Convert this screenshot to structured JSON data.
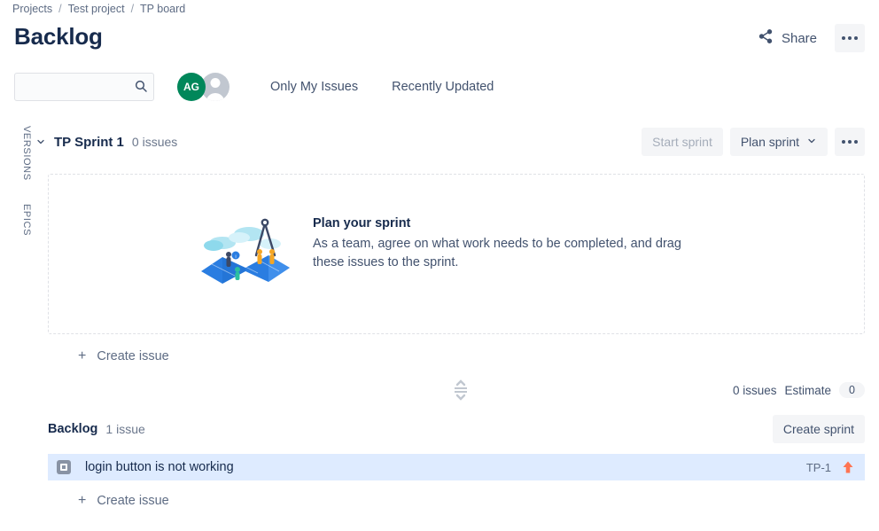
{
  "breadcrumb": {
    "items": [
      {
        "label": "Projects"
      },
      {
        "label": "Test project"
      },
      {
        "label": "TP board"
      }
    ],
    "separator": "/"
  },
  "header": {
    "title": "Backlog",
    "share_label": "Share",
    "share_icon": "share-icon",
    "more_icon": "ellipsis-icon"
  },
  "toolbar": {
    "search": {
      "value": "",
      "placeholder": "",
      "icon": "search-icon"
    },
    "avatars": [
      {
        "name": "avatar-ag",
        "initials": "AG",
        "color": "#00875a"
      },
      {
        "name": "avatar-anonymous",
        "initials": "",
        "color": "#c1c7d0"
      }
    ],
    "filters": [
      {
        "label": "Only My Issues"
      },
      {
        "label": "Recently Updated"
      }
    ]
  },
  "rail": {
    "versions_label": "VERSIONS",
    "epics_label": "EPICS"
  },
  "sprint": {
    "toggle_icon": "chevron-down-icon",
    "name": "TP Sprint 1",
    "issue_count": "0 issues",
    "start_button": "Start sprint",
    "plan_button": "Plan sprint",
    "plan_chevron_icon": "chevron-down-icon",
    "more_icon": "ellipsis-icon",
    "empty": {
      "illustration": "sprint-planning-map-illustration",
      "title": "Plan your sprint",
      "description": "As a team, agree on what work needs to be completed, and drag these issues to the sprint."
    },
    "create_issue_label": "Create issue",
    "create_issue_plus": "+",
    "stats": {
      "issues": "0 issues",
      "estimate_label": "Estimate",
      "estimate_value": "0"
    },
    "resize_handle_icon": "resize-handle-icon"
  },
  "backlog": {
    "name": "Backlog",
    "issue_count": "1 issue",
    "create_sprint_button": "Create sprint",
    "create_issue_label": "Create issue",
    "create_issue_plus": "+",
    "issues": [
      {
        "type_icon": "task-icon",
        "summary": "login button is not working",
        "key": "TP-1",
        "priority_icon": "priority-up-arrow-icon",
        "priority_color": "#ff7452",
        "selected": true
      }
    ]
  },
  "colors": {
    "selected_row": "#deebff",
    "accent_green": "#00875a",
    "text_primary": "#172b4d",
    "text_secondary": "#5e6c84",
    "button_bg": "#f4f5f7",
    "border": "#dfe1e6"
  }
}
